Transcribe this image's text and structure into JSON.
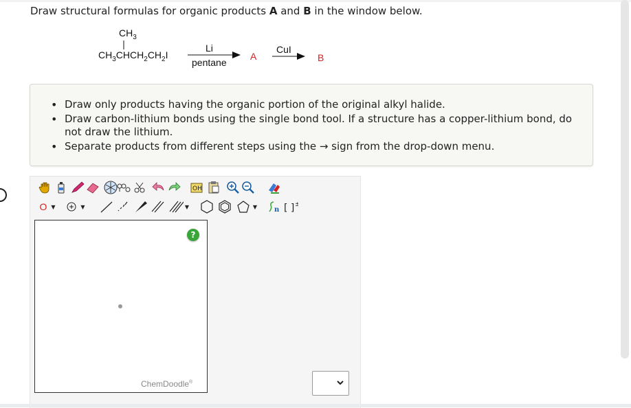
{
  "question": {
    "prefix": "Draw structural formulas for organic products ",
    "a": "A",
    "mid": " and ",
    "b": "B",
    "suffix": " in the window below."
  },
  "reaction": {
    "branch": "CH",
    "branch_sub": "3",
    "reactant_parts": [
      "CH",
      "3",
      "CHCH",
      "2",
      "CH",
      "2",
      "I"
    ],
    "reagent1_top": "Li",
    "reagent1_bottom": "pentane",
    "product1": "A",
    "reagent2_top": "CuI",
    "product2": "B"
  },
  "instructions": [
    "Draw only products having the organic portion of the original alkyl halide.",
    "Draw carbon-lithium bonds using the single bond tool. If a structure has a copper-lithium bond, do not draw the lithium.",
    "Separate products from different steps using the → sign from the drop-down menu."
  ],
  "toolbar_row1": [
    "hand-icon",
    "eraser-bottle-icon",
    "pencil-icon",
    "eraser-icon",
    "ring-template-icon",
    "cleanup-icon",
    "undo-icon",
    "redo-icon",
    "copy-icon",
    "paste-icon",
    "zoom-in-icon",
    "zoom-out-icon",
    "color-icon"
  ],
  "toolbar_row2": [
    "atom-o-icon",
    "charge-plus-icon",
    "single-bond-icon",
    "hashed-bond-icon",
    "wedge-bond-icon",
    "double-bond-icon",
    "triple-bond-icon",
    "cyclohexane-icon",
    "benzene-icon",
    "pentagon-icon",
    "sn-bracket-icon",
    "charge-bracket-icon"
  ],
  "editor": {
    "atom_label": "O",
    "help_label": "?",
    "watermark": "ChemDoodle",
    "watermark_mark": "®",
    "sn_label": "n",
    "charge_label": "±"
  },
  "colors": {
    "product_red": "#d42020",
    "help_green": "#3aa63a"
  }
}
